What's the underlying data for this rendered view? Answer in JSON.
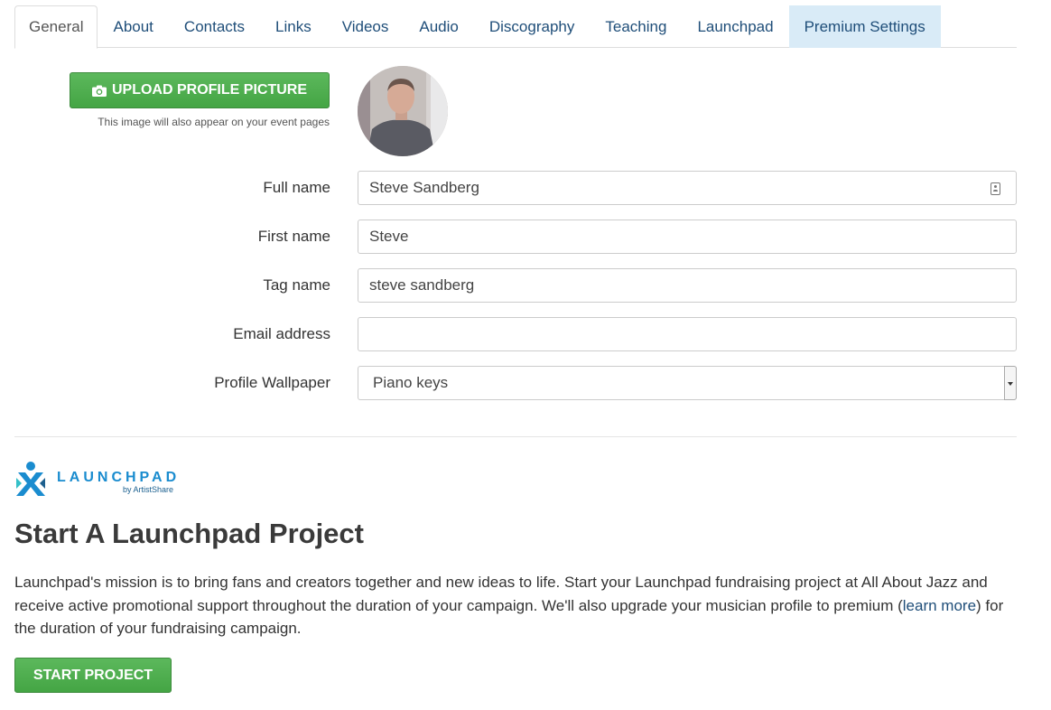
{
  "tabs": [
    {
      "label": "General",
      "active": true
    },
    {
      "label": "About"
    },
    {
      "label": "Contacts"
    },
    {
      "label": "Links"
    },
    {
      "label": "Videos"
    },
    {
      "label": "Audio"
    },
    {
      "label": "Discography"
    },
    {
      "label": "Teaching"
    },
    {
      "label": "Launchpad"
    },
    {
      "label": "Premium Settings",
      "highlight": true
    }
  ],
  "upload": {
    "button_label": "UPLOAD PROFILE PICTURE",
    "icon": "camera-icon",
    "hint": "This image will also appear on your event pages"
  },
  "form": {
    "full_name": {
      "label": "Full name",
      "value": "Steve Sandberg",
      "icon": "contact-card-icon"
    },
    "first_name": {
      "label": "First name",
      "value": "Steve"
    },
    "tag_name": {
      "label": "Tag name",
      "value": "steve sandberg"
    },
    "email": {
      "label": "Email address",
      "value": ""
    },
    "wallpaper": {
      "label": "Profile Wallpaper",
      "value": "Piano keys"
    }
  },
  "launchpad": {
    "logo_word": "LAUNCHPAD",
    "logo_by": "by ArtistShare",
    "title": "Start A Launchpad Project",
    "desc_part1": "Launchpad's mission is to bring fans and creators together and new ideas to life. Start your Launchpad fundraising project at All About Jazz and receive active promotional support throughout the duration of your campaign. We'll also upgrade your musician profile to premium (",
    "learn_more": "learn more",
    "desc_part2": ") for the duration of your fundraising campaign.",
    "start_label": "START PROJECT"
  },
  "colors": {
    "accent_green": "#44a544",
    "link_blue": "#1f4e79",
    "premium_tab_bg": "#d9ebf7",
    "launchpad_blue": "#1a8ccf"
  }
}
